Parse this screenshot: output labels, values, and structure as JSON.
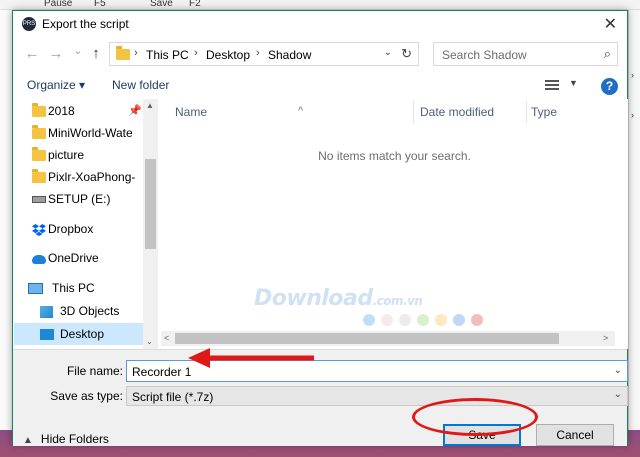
{
  "background": {
    "top_labels": [
      "Pause",
      "F5",
      "Save",
      "F2"
    ]
  },
  "dialog": {
    "title": "Export the script",
    "app_icon_text": "PRS",
    "close_glyph": "✕"
  },
  "address_bar": {
    "back_glyph": "←",
    "forward_glyph": "→",
    "history_glyph": "⌄",
    "up_glyph": "↑",
    "breadcrumbs": [
      "This PC",
      "Desktop",
      "Shadow"
    ],
    "separator": "›",
    "refresh_glyph": "↻"
  },
  "search": {
    "placeholder": "Search Shadow",
    "icon": "search-icon"
  },
  "toolbar": {
    "organize_label": "Organize ▾",
    "new_folder_label": "New folder",
    "help_label": "?"
  },
  "navigation": {
    "items": [
      {
        "label": "2018",
        "icon": "folder-icon",
        "pinned": true
      },
      {
        "label": "MiniWorld-Wate",
        "icon": "folder-icon"
      },
      {
        "label": "picture",
        "icon": "folder-icon"
      },
      {
        "label": "Pixlr-XoaPhong-",
        "icon": "folder-icon"
      },
      {
        "label": "SETUP (E:)",
        "icon": "drive-icon"
      },
      {
        "label": "Dropbox",
        "icon": "dropbox-icon"
      },
      {
        "label": "OneDrive",
        "icon": "cloud-icon"
      },
      {
        "label": "This PC",
        "icon": "computer-icon"
      },
      {
        "label": "3D Objects",
        "icon": "cube-icon"
      },
      {
        "label": "Desktop",
        "icon": "desktop-icon",
        "selected": true
      }
    ]
  },
  "file_list": {
    "columns": [
      "Name",
      "Date modified",
      "Type"
    ],
    "sort_glyph": "^",
    "empty_message": "No items match your search."
  },
  "watermark": {
    "text": "Download",
    "suffix": ".com.vn",
    "dot_colors": [
      "#4aa3df",
      "#e8c4c4",
      "#c8c8c8",
      "#8ed36a",
      "#f3c04f",
      "#4a8fd9",
      "#e04040"
    ]
  },
  "form": {
    "filename_label": "File name:",
    "filename_value": "Recorder 1",
    "savetype_label": "Save as type:",
    "savetype_value": "Script file (*.7z)",
    "dropdown_glyph": "⌄"
  },
  "footer": {
    "hide_folders_label": "Hide Folders",
    "save_label": "Save",
    "cancel_label": "Cancel"
  },
  "colors": {
    "accent": "#0078d7",
    "annotation_red": "#e01818",
    "selection": "#cce8ff"
  }
}
